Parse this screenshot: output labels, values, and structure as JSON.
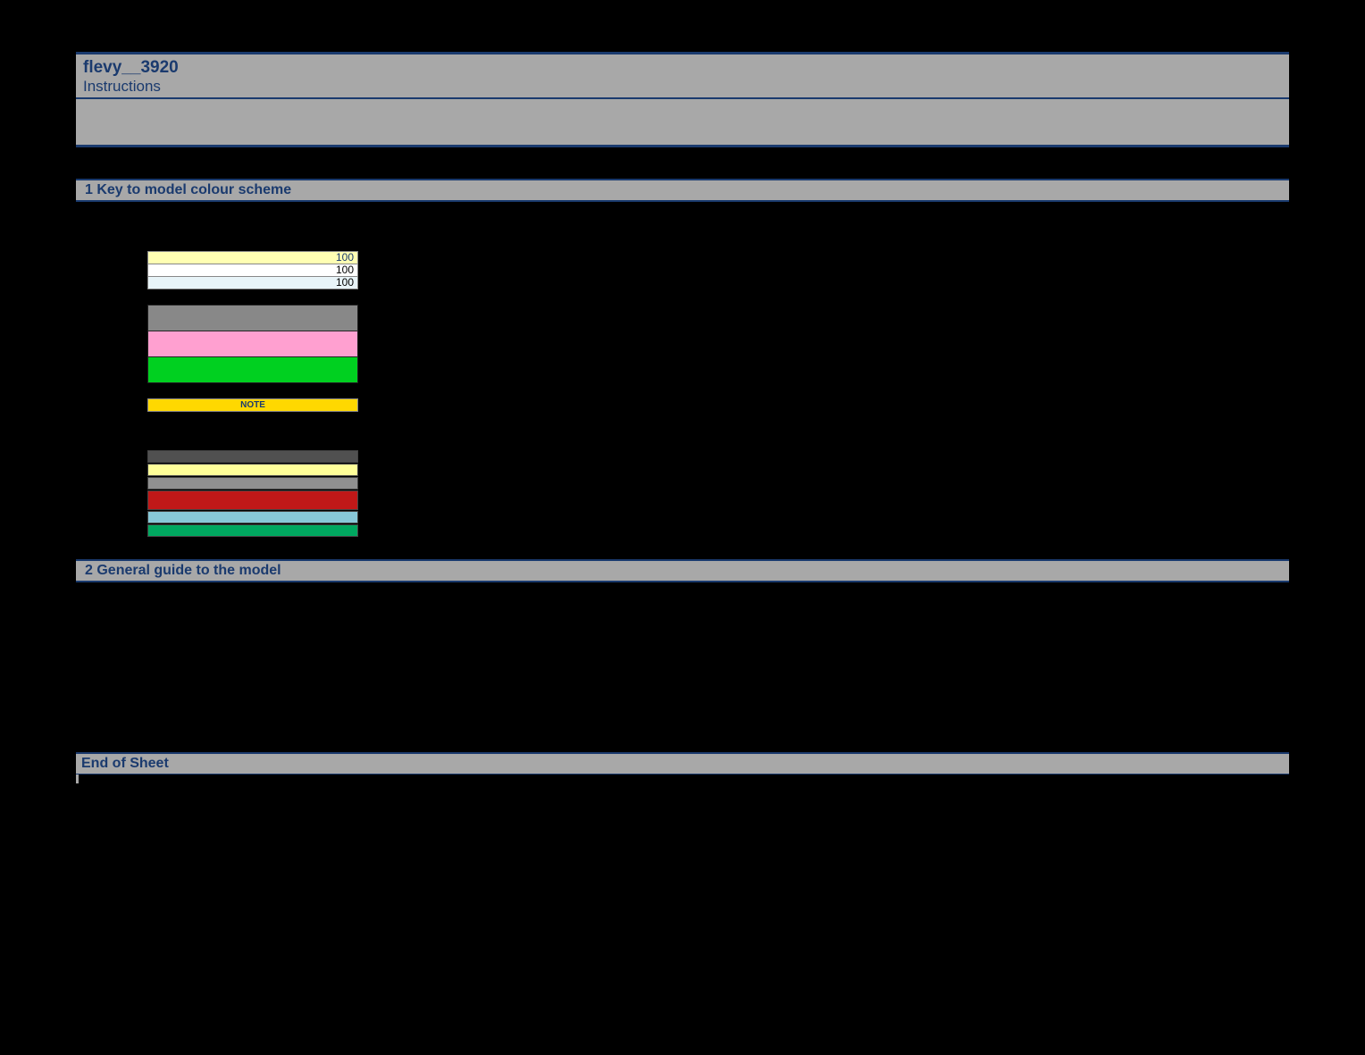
{
  "header": {
    "title": "flevy__3920",
    "subtitle": "Instructions"
  },
  "section1": {
    "heading": "1 Key to model colour scheme",
    "swatches": {
      "row1_value": "100",
      "row2_value": "100",
      "row3_value": "100",
      "note_label": "NOTE"
    }
  },
  "section2": {
    "heading": "2 General guide to the model"
  },
  "footer": {
    "label": "End of Sheet"
  },
  "colors": {
    "yellow_light": "#ffffb3",
    "white": "#ffffff",
    "lightblue": "#e8f4f8",
    "gray": "#888888",
    "pink": "#ffa0d0",
    "green": "#00d020",
    "note_yellow": "#ffd800",
    "darkgray": "#505050",
    "yellow2": "#ffff99",
    "midgray": "#909090",
    "red": "#c01818",
    "cyan": "#88c8d8",
    "emerald": "#00a860"
  }
}
